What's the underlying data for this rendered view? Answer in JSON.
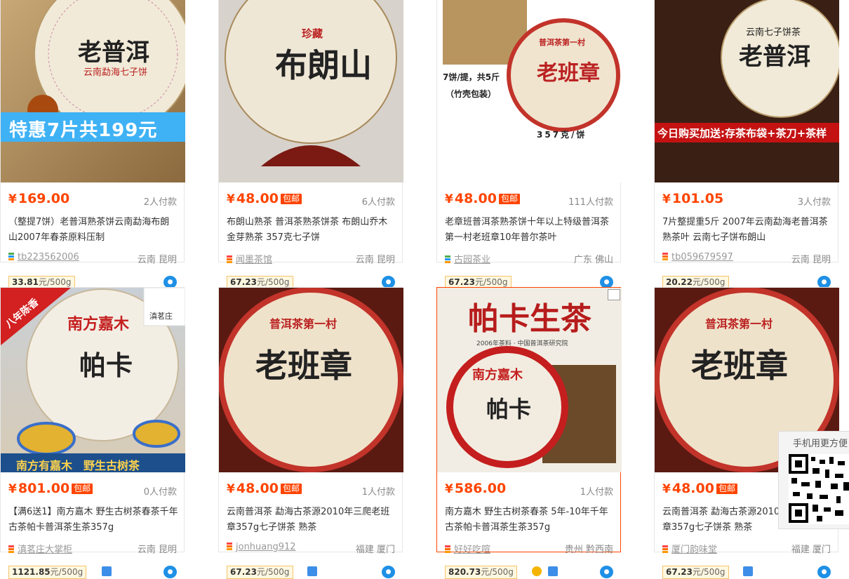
{
  "currency": "¥",
  "baoyou_label": "包邮",
  "products": [
    {
      "price": "169.00",
      "baoyou": false,
      "deals": "2人付款",
      "title": "（整提7饼）老普洱熟茶饼云南勐海布朗山2007年春茶原料压制",
      "shop": "tb223562006",
      "location": "云南 昆明",
      "unit_price": "33.81",
      "unit_suffix": "元/500g",
      "image_banner": "特惠7片共199元",
      "image_text": "老普洱",
      "image_subtext": "云南勐海七子饼",
      "highlighted": false
    },
    {
      "price": "48.00",
      "baoyou": true,
      "deals": "6人付款",
      "title": "布朗山熟茶 普洱茶熟茶饼茶 布朗山乔木金芽熟茶 357克七子饼",
      "shop": "闻墨茶馆",
      "location": "云南 昆明",
      "unit_price": "67.23",
      "unit_suffix": "元/500g",
      "image_banner": "",
      "image_text": "布朗山",
      "image_subtext": "珍藏",
      "highlighted": false
    },
    {
      "price": "48.00",
      "baoyou": true,
      "deals": "111人付款",
      "title": "老章班普洱茶熟茶饼十年以上特级普洱茶第一村老班章10年普尔茶叶",
      "shop": "古园茶业",
      "location": "广东 佛山",
      "unit_price": "67.23",
      "unit_suffix": "元/500g",
      "image_banner": "",
      "image_text": "老班章",
      "image_subtext": "普洱茶第一村",
      "image_note1": "7饼/提，共5斤",
      "image_note2": "（竹壳包装）",
      "image_note3": "357克/饼",
      "highlighted": false
    },
    {
      "price": "101.05",
      "baoyou": false,
      "deals": "3人付款",
      "title": "7片整提重5斤 2007年云南勐海老普洱茶熟茶叶 云南七子饼布朗山",
      "shop": "tb059679597",
      "location": "云南 昆明",
      "unit_price": "20.22",
      "unit_suffix": "元/500g",
      "image_banner": "今日购买加送:存茶布袋+茶刀+茶样",
      "image_text": "老普洱",
      "image_subtext": "云南七子饼茶",
      "highlighted": false
    },
    {
      "price": "801.00",
      "baoyou": true,
      "deals": "0人付款",
      "title": "【满6送1】南方嘉木 野生古树茶春茶千年古茶帕卡普洱茶生茶357g",
      "shop": "滇茗庄大掌柜",
      "location": "云南 昆明",
      "unit_price": "1121.85",
      "unit_suffix": "元/500g",
      "image_banner": "南方有嘉木　野生古树茶",
      "image_text": "帕卡",
      "image_subtext": "南方嘉木",
      "image_ribbon": "八年陈香",
      "image_logo": "滇茗庄",
      "highlighted": false
    },
    {
      "price": "48.00",
      "baoyou": true,
      "deals": "1人付款",
      "title": "云南普洱茶 勐海古茶源2010年三爬老班章357g七子饼茶 熟茶",
      "shop": "jonhuang912",
      "location": "福建 厦门",
      "unit_price": "67.23",
      "unit_suffix": "元/500g",
      "image_banner": "",
      "image_text": "老班章",
      "image_subtext": "普洱茶第一村",
      "highlighted": false
    },
    {
      "price": "586.00",
      "baoyou": false,
      "deals": "1人付款",
      "title": "南方嘉木 野生古树茶春茶 5年-10年千年古茶帕卡普洱茶生茶357g",
      "shop": "好好吃喧",
      "location": "贵州 黔西南",
      "unit_price": "820.73",
      "unit_suffix": "元/500g",
      "image_banner": "",
      "image_text": "帕卡",
      "image_subtext": "南方嘉木",
      "image_heading": "帕卡生茶",
      "image_caption": "2006年茶料 · 中国普洱茶研究院",
      "highlighted": true
    },
    {
      "price": "48.00",
      "baoyou": true,
      "deals": "",
      "title": "云南普洱茶 勐海古茶源2010年三爬老班章357g七子饼茶 熟茶",
      "shop": "厦门韵味堂",
      "location": "福建 厦门",
      "unit_price": "67.23",
      "unit_suffix": "元/500g",
      "image_banner": "",
      "image_text": "老班章",
      "image_subtext": "普洱茶第一村",
      "highlighted": false
    }
  ],
  "qr_panel": {
    "title": "手机用更方便"
  },
  "colors": {
    "accent": "#ff4400",
    "border": "#e6e6e6",
    "unit_bg": "#fff8e1"
  }
}
